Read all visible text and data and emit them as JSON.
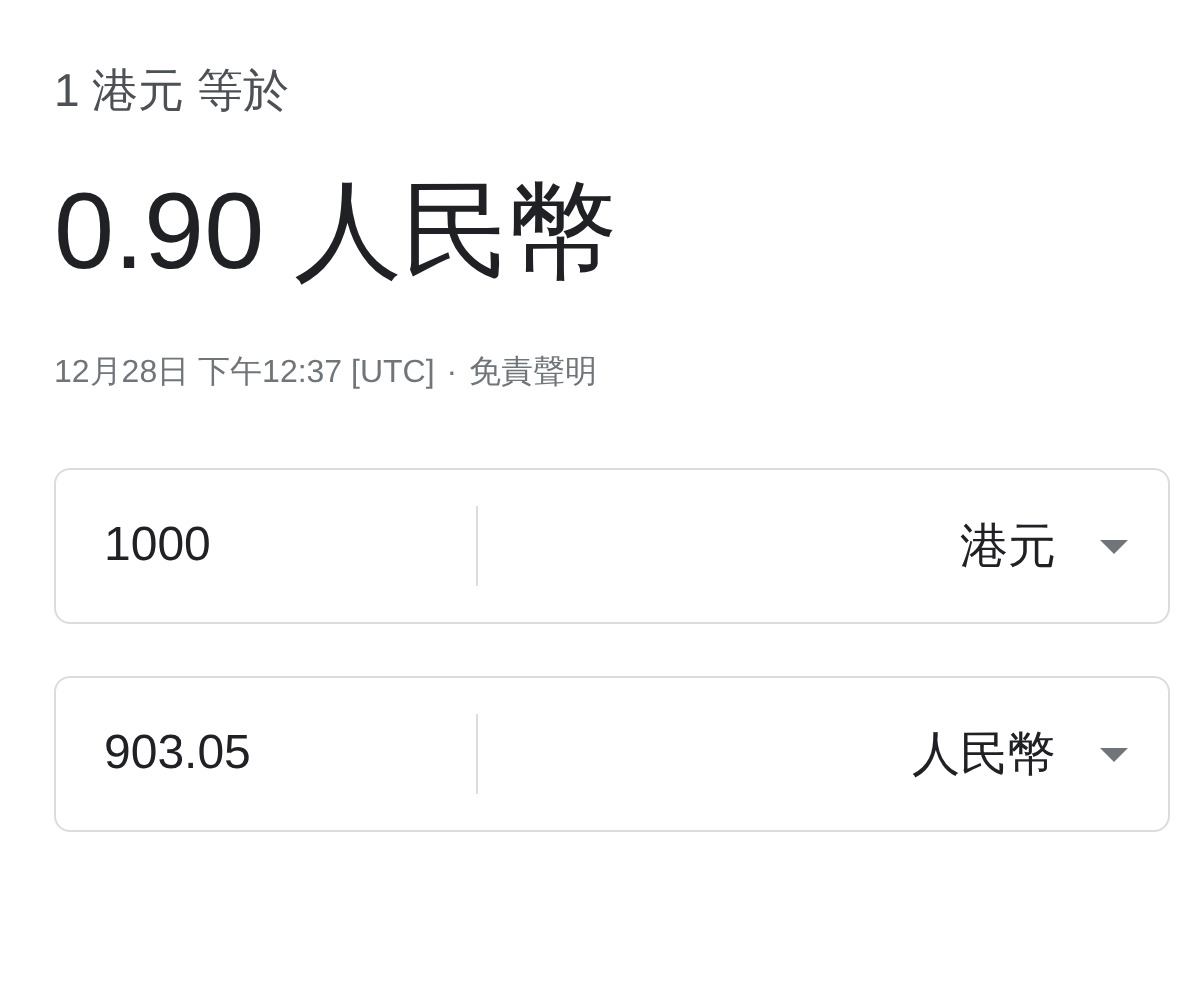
{
  "header": {
    "from_text": "1 港元 等於",
    "result": "0.90 人民幣",
    "timestamp": "12月28日 下午12:37 [UTC]",
    "separator": "·",
    "disclaimer": "免責聲明"
  },
  "converters": [
    {
      "value": "1000",
      "currency": "港元"
    },
    {
      "value": "903.05",
      "currency": "人民幣"
    }
  ]
}
